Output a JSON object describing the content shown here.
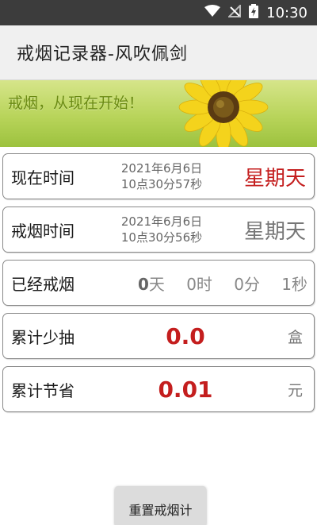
{
  "status_bar": {
    "time": "10:30"
  },
  "app": {
    "title": "戒烟记录器-风吹佩剑"
  },
  "banner": {
    "text": "戒烟，从现在开始！"
  },
  "rows": {
    "current": {
      "label": "现在时间",
      "date": "2021年6月6日",
      "time": "10点30分57秒",
      "weekday": "星期天"
    },
    "quit": {
      "label": "戒烟时间",
      "date": "2021年6月6日",
      "time": "10点30分56秒",
      "weekday": "星期天"
    },
    "elapsed": {
      "label": "已经戒烟",
      "days_num": "0",
      "days_unit": "天",
      "hours": "0时",
      "minutes": "0分",
      "seconds": "1秒"
    },
    "saved_packs": {
      "label": "累计少抽",
      "value": "0.0",
      "unit": "盒"
    },
    "saved_money": {
      "label": "累计节省",
      "value": "0.01",
      "unit": "元"
    }
  },
  "reset_button": {
    "label": "重置戒烟计"
  },
  "colors": {
    "accent_red": "#c41e1e",
    "weekday_gray": "#777777",
    "status_bar": "#3c3c3c"
  }
}
